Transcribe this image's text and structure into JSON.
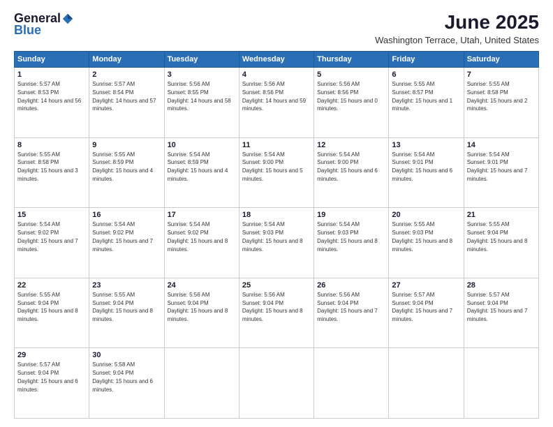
{
  "logo": {
    "general": "General",
    "blue": "Blue"
  },
  "header": {
    "title": "June 2025",
    "subtitle": "Washington Terrace, Utah, United States"
  },
  "weekdays": [
    "Sunday",
    "Monday",
    "Tuesday",
    "Wednesday",
    "Thursday",
    "Friday",
    "Saturday"
  ],
  "weeks": [
    [
      {
        "day": 1,
        "sunrise": "5:57 AM",
        "sunset": "8:53 PM",
        "daylight": "14 hours and 56 minutes."
      },
      {
        "day": 2,
        "sunrise": "5:57 AM",
        "sunset": "8:54 PM",
        "daylight": "14 hours and 57 minutes."
      },
      {
        "day": 3,
        "sunrise": "5:56 AM",
        "sunset": "8:55 PM",
        "daylight": "14 hours and 58 minutes."
      },
      {
        "day": 4,
        "sunrise": "5:56 AM",
        "sunset": "8:56 PM",
        "daylight": "14 hours and 59 minutes."
      },
      {
        "day": 5,
        "sunrise": "5:56 AM",
        "sunset": "8:56 PM",
        "daylight": "15 hours and 0 minutes."
      },
      {
        "day": 6,
        "sunrise": "5:55 AM",
        "sunset": "8:57 PM",
        "daylight": "15 hours and 1 minute."
      },
      {
        "day": 7,
        "sunrise": "5:55 AM",
        "sunset": "8:58 PM",
        "daylight": "15 hours and 2 minutes."
      }
    ],
    [
      {
        "day": 8,
        "sunrise": "5:55 AM",
        "sunset": "8:58 PM",
        "daylight": "15 hours and 3 minutes."
      },
      {
        "day": 9,
        "sunrise": "5:55 AM",
        "sunset": "8:59 PM",
        "daylight": "15 hours and 4 minutes."
      },
      {
        "day": 10,
        "sunrise": "5:54 AM",
        "sunset": "8:59 PM",
        "daylight": "15 hours and 4 minutes."
      },
      {
        "day": 11,
        "sunrise": "5:54 AM",
        "sunset": "9:00 PM",
        "daylight": "15 hours and 5 minutes."
      },
      {
        "day": 12,
        "sunrise": "5:54 AM",
        "sunset": "9:00 PM",
        "daylight": "15 hours and 6 minutes."
      },
      {
        "day": 13,
        "sunrise": "5:54 AM",
        "sunset": "9:01 PM",
        "daylight": "15 hours and 6 minutes."
      },
      {
        "day": 14,
        "sunrise": "5:54 AM",
        "sunset": "9:01 PM",
        "daylight": "15 hours and 7 minutes."
      }
    ],
    [
      {
        "day": 15,
        "sunrise": "5:54 AM",
        "sunset": "9:02 PM",
        "daylight": "15 hours and 7 minutes."
      },
      {
        "day": 16,
        "sunrise": "5:54 AM",
        "sunset": "9:02 PM",
        "daylight": "15 hours and 7 minutes."
      },
      {
        "day": 17,
        "sunrise": "5:54 AM",
        "sunset": "9:02 PM",
        "daylight": "15 hours and 8 minutes."
      },
      {
        "day": 18,
        "sunrise": "5:54 AM",
        "sunset": "9:03 PM",
        "daylight": "15 hours and 8 minutes."
      },
      {
        "day": 19,
        "sunrise": "5:54 AM",
        "sunset": "9:03 PM",
        "daylight": "15 hours and 8 minutes."
      },
      {
        "day": 20,
        "sunrise": "5:55 AM",
        "sunset": "9:03 PM",
        "daylight": "15 hours and 8 minutes."
      },
      {
        "day": 21,
        "sunrise": "5:55 AM",
        "sunset": "9:04 PM",
        "daylight": "15 hours and 8 minutes."
      }
    ],
    [
      {
        "day": 22,
        "sunrise": "5:55 AM",
        "sunset": "9:04 PM",
        "daylight": "15 hours and 8 minutes."
      },
      {
        "day": 23,
        "sunrise": "5:55 AM",
        "sunset": "9:04 PM",
        "daylight": "15 hours and 8 minutes."
      },
      {
        "day": 24,
        "sunrise": "5:56 AM",
        "sunset": "9:04 PM",
        "daylight": "15 hours and 8 minutes."
      },
      {
        "day": 25,
        "sunrise": "5:56 AM",
        "sunset": "9:04 PM",
        "daylight": "15 hours and 8 minutes."
      },
      {
        "day": 26,
        "sunrise": "5:56 AM",
        "sunset": "9:04 PM",
        "daylight": "15 hours and 7 minutes."
      },
      {
        "day": 27,
        "sunrise": "5:57 AM",
        "sunset": "9:04 PM",
        "daylight": "15 hours and 7 minutes."
      },
      {
        "day": 28,
        "sunrise": "5:57 AM",
        "sunset": "9:04 PM",
        "daylight": "15 hours and 7 minutes."
      }
    ],
    [
      {
        "day": 29,
        "sunrise": "5:57 AM",
        "sunset": "9:04 PM",
        "daylight": "15 hours and 6 minutes."
      },
      {
        "day": 30,
        "sunrise": "5:58 AM",
        "sunset": "9:04 PM",
        "daylight": "15 hours and 6 minutes."
      },
      null,
      null,
      null,
      null,
      null
    ]
  ]
}
